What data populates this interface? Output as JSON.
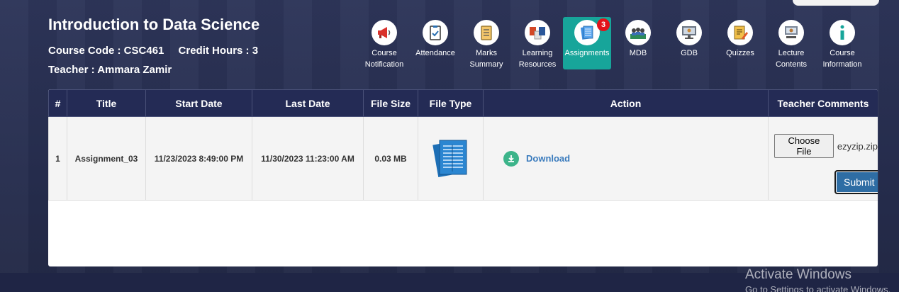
{
  "course": {
    "title": "Introduction to Data Science",
    "code": "Course Code : CSC461",
    "credit_hours": "Credit Hours : 3",
    "teacher": "Teacher : Ammara Zamir"
  },
  "nav": {
    "items": [
      {
        "label_1": "Course",
        "label_2": "Notification",
        "icon": "megaphone-icon"
      },
      {
        "label_1": "Attendance",
        "label_2": "",
        "icon": "clipboard-check-icon"
      },
      {
        "label_1": "Marks",
        "label_2": "Summary",
        "icon": "checklist-icon"
      },
      {
        "label_1": "Learning",
        "label_2": "Resources",
        "icon": "office-files-icon"
      },
      {
        "label_1": "Assignments",
        "label_2": "",
        "icon": "assignment-book-icon",
        "active": true,
        "badge": "3"
      },
      {
        "label_1": "MDB",
        "label_2": "",
        "icon": "group-discussion-icon"
      },
      {
        "label_1": "GDB",
        "label_2": "",
        "icon": "monitor-presenter-icon"
      },
      {
        "label_1": "Quizzes",
        "label_2": "",
        "icon": "quiz-pencil-icon"
      },
      {
        "label_1": "Lecture",
        "label_2": "Contents",
        "icon": "lecture-presenter-icon"
      },
      {
        "label_1": "Course",
        "label_2": "Information",
        "icon": "info-icon"
      }
    ]
  },
  "table": {
    "headers": [
      "#",
      "Title",
      "Start Date",
      "Last Date",
      "File Size",
      "File Type",
      "Action",
      "Teacher Comments"
    ],
    "rows": [
      {
        "index": "1",
        "title": "Assignment_03",
        "start_date": "11/23/2023 8:49:00 PM",
        "last_date": "11/30/2023 11:23:00 AM",
        "file_size": "0.03 MB",
        "file_type_icon": "document-stack-icon",
        "download_label": "Download",
        "choose_file_label": "Choose File",
        "chosen_file": "ezyzip.zip",
        "submit_label": "Submit",
        "teacher_comments": ""
      }
    ]
  },
  "watermark": {
    "title": "Activate Windows",
    "subtitle": "Go to Settings to activate Windows."
  },
  "colors": {
    "header_bg": "#242b55",
    "active_tab": "#17a59a",
    "badge": "#e3141b",
    "submit": "#2e6da4",
    "download": "#3a7bbd"
  }
}
